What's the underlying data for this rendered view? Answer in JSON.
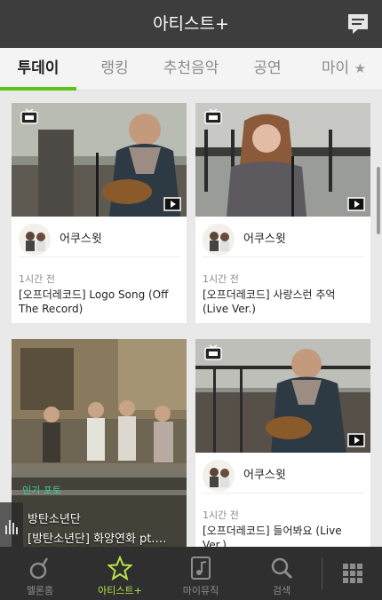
{
  "header": {
    "title": "아티스트+",
    "chat_icon": "chat-bubble-icon"
  },
  "tabs": [
    {
      "label": "투데이",
      "active": true
    },
    {
      "label": "랭킹",
      "active": false
    },
    {
      "label": "추천음악",
      "active": false
    },
    {
      "label": "공연",
      "active": false
    },
    {
      "label": "마이",
      "active": false
    }
  ],
  "colors": {
    "accent": "#5bc418",
    "header_bg": "#3d3d3d",
    "nav_bg": "#2f2f2f",
    "photo_label": "#38d0a5"
  },
  "cards": [
    {
      "artist": "어쿠스윗",
      "time": "1시간 전",
      "title": "[오프더레코드] Logo Song (Off The Record)"
    },
    {
      "artist": "어쿠스윗",
      "time": "1시간 전",
      "title": "[오프더레코드] 사랑스런 추억 (Live Ver.)"
    },
    {
      "label": "인기 포토",
      "sub1": "방탄소년단",
      "sub2": "[방탄소년단] 화양연화 pt.…"
    },
    {
      "artist": "어쿠스윗",
      "time": "1시간 전",
      "title": "[오프더레코드] 들어봐요 (Live Ver.)"
    }
  ],
  "bottom_nav": [
    {
      "label": "멜론홈",
      "icon": "melon-note-icon"
    },
    {
      "label": "아티스트+",
      "icon": "star-icon",
      "active": true
    },
    {
      "label": "마이뮤직",
      "icon": "music-file-icon"
    },
    {
      "label": "검색",
      "icon": "search-icon"
    },
    {
      "label": "",
      "icon": "grid-menu-icon"
    }
  ]
}
